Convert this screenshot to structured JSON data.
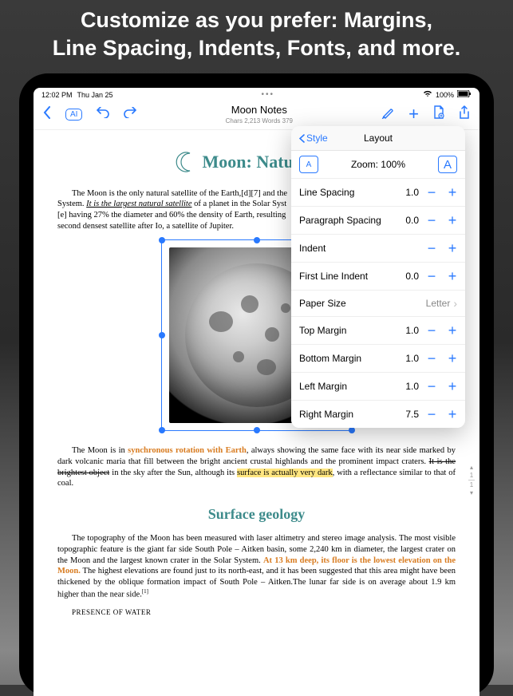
{
  "promo": {
    "line1": "Customize as you prefer: Margins,",
    "line2": "Line Spacing, Indents, Fonts, and more."
  },
  "statusbar": {
    "time": "12:02 PM",
    "date": "Thu Jan 25",
    "battery": "100%"
  },
  "toolbar": {
    "ai_label": "AI",
    "doc_title": "Moon Notes",
    "stats": "Chars 2,213 Words 379"
  },
  "document": {
    "heading": "Moon: Natural Sa",
    "para1_a": "The Moon is the only natural satellite of the Earth,[d][7] and the",
    "para1_b": "System. ",
    "para1_underline": "It is the largest natural satellite",
    "para1_c": " of a planet in the Solar Syst",
    "para1_d": "[e] having 27% the diameter and 60% the density of Earth, resulting",
    "para1_e": "second densest satellite after Io, a satellite of Jupiter.",
    "para2_a": "The Moon is in ",
    "para2_orange": "synchronous rotation with Earth",
    "para2_b": ", always showing the same face with its near side marked by dark volcanic maria that fill between the bright ancient crustal highlands and the prominent impact craters. ",
    "para2_strike": "It is the brightest object",
    "para2_c": " in the sky after the Sun, although its ",
    "para2_hl": "surface is actually very dark",
    "para2_d": ", with a reflectance similar to that of coal.",
    "subheading": "Surface geology",
    "para3_a": "The topography of the Moon has been measured with laser altimetry and stereo image analysis. The most visible topographic feature is the giant far side South Pole – Aitken basin, some 2,240 km in diameter, the largest crater on the Moon and the largest known crater in the Solar System. ",
    "para3_orange": "At 13 km deep, its floor is the lowest elevation on the Moon.",
    "para3_b": " The highest elevations are found just to its north-east, and it has been suggested that this area might have been thickened by the oblique formation impact of South Pole – Aitken.The lunar far side is on average about 1.9 km higher than the near side.",
    "para3_sup": "[1]",
    "section_label": "PRESENCE OF WATER"
  },
  "popover": {
    "back_label": "Style",
    "title": "Layout",
    "zoom_label": "Zoom: 100%",
    "rows": [
      {
        "label": "Line Spacing",
        "value": "1.0"
      },
      {
        "label": "Paragraph Spacing",
        "value": "0.0"
      },
      {
        "label": "Indent",
        "value": ""
      },
      {
        "label": "First Line Indent",
        "value": "0.0"
      }
    ],
    "paper_label": "Paper Size",
    "paper_value": "Letter",
    "margins": [
      {
        "label": "Top Margin",
        "value": "1.0"
      },
      {
        "label": "Bottom Margin",
        "value": "1.0"
      },
      {
        "label": "Left Margin",
        "value": "1.0"
      },
      {
        "label": "Right Margin",
        "value": "7.5"
      }
    ]
  },
  "pager": {
    "up": "▴",
    "p1": "1",
    "p2": "1",
    "down": "▾"
  }
}
